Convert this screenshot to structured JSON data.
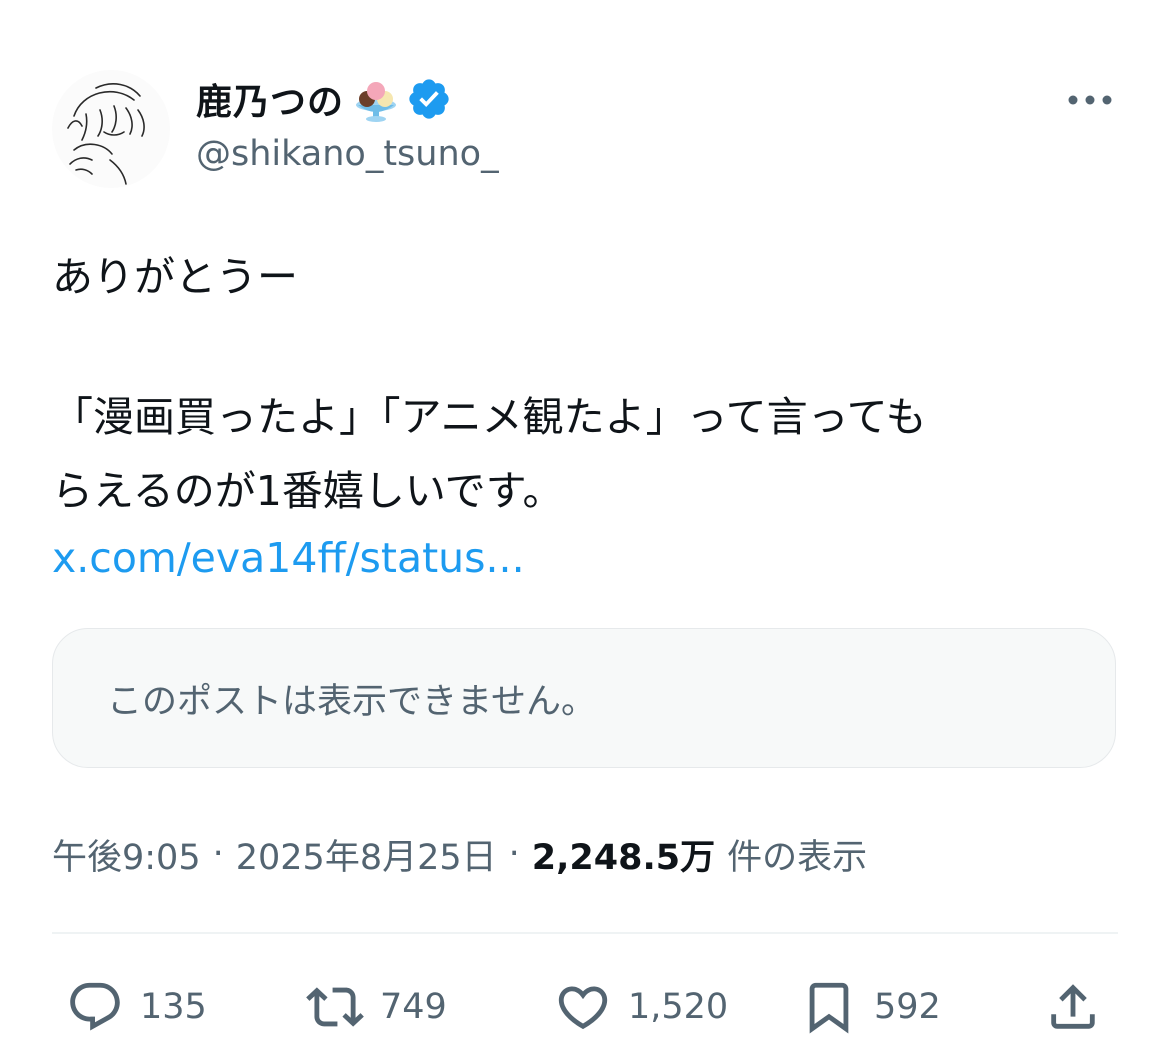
{
  "author": {
    "display_name": "鹿乃つの",
    "handle": "@shikano_tsuno_",
    "emoji_icon": "ice-cream-icon",
    "verified_icon": "verified-badge-icon",
    "verified_color": "#1d9bf0"
  },
  "tweet": {
    "lines": [
      "ありがとうー",
      "",
      "「漫画買ったよ」「アニメ観たよ」って言っても",
      "らえるのが1番嬉しいです。"
    ],
    "link_text": "x.com/eva14ff/status..."
  },
  "quote": {
    "unavailable_text": "このポストは表示できません。"
  },
  "meta": {
    "time": "午後9:05",
    "separator": "·",
    "date": "2025年8月25日",
    "views_count": "2,248.5万",
    "views_label": "件の表示"
  },
  "actions": {
    "replies": "135",
    "reposts": "749",
    "likes": "1,520",
    "bookmarks": "592"
  },
  "colors": {
    "accent": "#1d9bf0",
    "secondary_text": "#536471",
    "primary_text": "#0f1419"
  }
}
